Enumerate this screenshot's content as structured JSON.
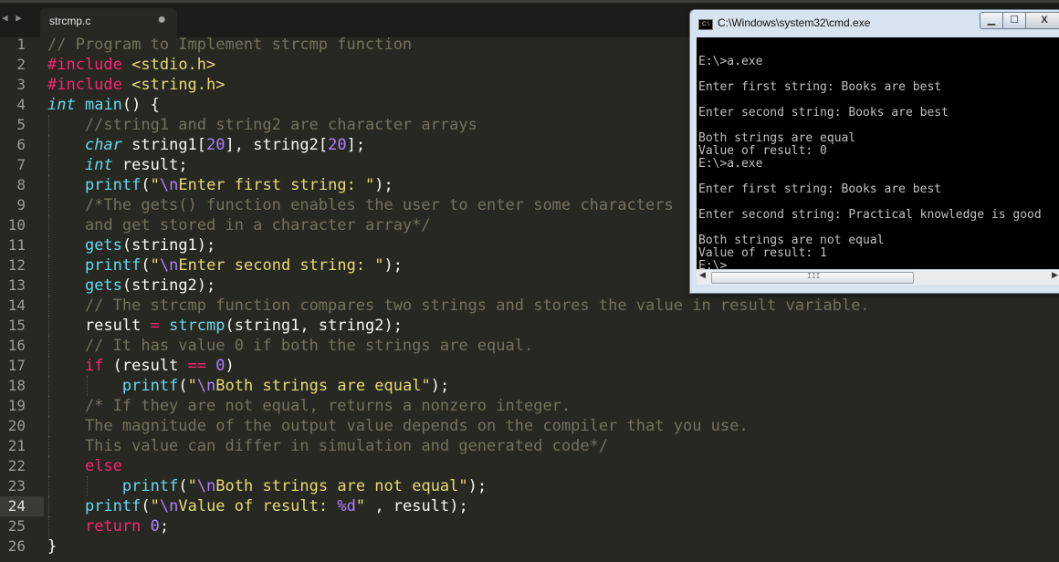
{
  "editor": {
    "tab": {
      "filename": "strcmp.c",
      "modified_dot": "●"
    },
    "nav_arrows": "◀ ▶",
    "active_line": 24,
    "lines": [
      {
        "n": "1",
        "segs": [
          {
            "c": "c",
            "t": "// Program to Implement strcmp function"
          }
        ]
      },
      {
        "n": "2",
        "segs": [
          {
            "c": "k",
            "t": "#include"
          },
          {
            "c": "p",
            "t": " "
          },
          {
            "c": "s",
            "t": "<stdio.h>"
          }
        ]
      },
      {
        "n": "3",
        "segs": [
          {
            "c": "k",
            "t": "#include"
          },
          {
            "c": "p",
            "t": " "
          },
          {
            "c": "s",
            "t": "<string.h>"
          }
        ]
      },
      {
        "n": "4",
        "segs": [
          {
            "c": "t",
            "t": "int"
          },
          {
            "c": "p",
            "t": " "
          },
          {
            "c": "f",
            "t": "main"
          },
          {
            "c": "p",
            "t": "() {"
          }
        ]
      },
      {
        "n": "5",
        "segs": [
          {
            "c": "c",
            "t": "    //string1 and string2 are character arrays"
          }
        ]
      },
      {
        "n": "6",
        "segs": [
          {
            "c": "p",
            "t": "    "
          },
          {
            "c": "t",
            "t": "char"
          },
          {
            "c": "p",
            "t": " string1["
          },
          {
            "c": "n",
            "t": "20"
          },
          {
            "c": "p",
            "t": "], string2["
          },
          {
            "c": "n",
            "t": "20"
          },
          {
            "c": "p",
            "t": "];"
          }
        ]
      },
      {
        "n": "7",
        "segs": [
          {
            "c": "p",
            "t": "    "
          },
          {
            "c": "t",
            "t": "int"
          },
          {
            "c": "p",
            "t": " result;"
          }
        ]
      },
      {
        "n": "8",
        "segs": [
          {
            "c": "p",
            "t": "    "
          },
          {
            "c": "f",
            "t": "printf"
          },
          {
            "c": "p",
            "t": "("
          },
          {
            "c": "s",
            "t": "\""
          },
          {
            "c": "e",
            "t": "\\n"
          },
          {
            "c": "s",
            "t": "Enter first string: \""
          },
          {
            "c": "p",
            "t": ");"
          }
        ]
      },
      {
        "n": "9",
        "segs": [
          {
            "c": "c",
            "t": "    /*The gets() function enables the user to enter some characters"
          }
        ]
      },
      {
        "n": "10",
        "segs": [
          {
            "c": "c",
            "t": "    and get stored in a character array*/"
          }
        ]
      },
      {
        "n": "11",
        "segs": [
          {
            "c": "p",
            "t": "    "
          },
          {
            "c": "f",
            "t": "gets"
          },
          {
            "c": "p",
            "t": "(string1);"
          }
        ]
      },
      {
        "n": "12",
        "segs": [
          {
            "c": "p",
            "t": "    "
          },
          {
            "c": "f",
            "t": "printf"
          },
          {
            "c": "p",
            "t": "("
          },
          {
            "c": "s",
            "t": "\""
          },
          {
            "c": "e",
            "t": "\\n"
          },
          {
            "c": "s",
            "t": "Enter second string: \""
          },
          {
            "c": "p",
            "t": ");"
          }
        ]
      },
      {
        "n": "13",
        "segs": [
          {
            "c": "p",
            "t": "    "
          },
          {
            "c": "f",
            "t": "gets"
          },
          {
            "c": "p",
            "t": "(string2);"
          }
        ]
      },
      {
        "n": "14",
        "segs": [
          {
            "c": "c",
            "t": "    // The strcmp function compares two strings and stores the value in result variable."
          }
        ]
      },
      {
        "n": "15",
        "segs": [
          {
            "c": "p",
            "t": "    result "
          },
          {
            "c": "k",
            "t": "="
          },
          {
            "c": "p",
            "t": " "
          },
          {
            "c": "f",
            "t": "strcmp"
          },
          {
            "c": "p",
            "t": "(string1, string2);"
          }
        ]
      },
      {
        "n": "16",
        "segs": [
          {
            "c": "c",
            "t": "    // It has value 0 if both the strings are equal."
          }
        ]
      },
      {
        "n": "17",
        "segs": [
          {
            "c": "p",
            "t": "    "
          },
          {
            "c": "k",
            "t": "if"
          },
          {
            "c": "p",
            "t": " (result "
          },
          {
            "c": "k",
            "t": "=="
          },
          {
            "c": "p",
            "t": " "
          },
          {
            "c": "n",
            "t": "0"
          },
          {
            "c": "p",
            "t": ")"
          }
        ]
      },
      {
        "n": "18",
        "segs": [
          {
            "c": "p",
            "t": "        "
          },
          {
            "c": "f",
            "t": "printf"
          },
          {
            "c": "p",
            "t": "("
          },
          {
            "c": "s",
            "t": "\""
          },
          {
            "c": "e",
            "t": "\\n"
          },
          {
            "c": "s",
            "t": "Both strings are equal\""
          },
          {
            "c": "p",
            "t": ");"
          }
        ]
      },
      {
        "n": "19",
        "segs": [
          {
            "c": "c",
            "t": "    /* If they are not equal, returns a nonzero integer."
          }
        ]
      },
      {
        "n": "20",
        "segs": [
          {
            "c": "c",
            "t": "    The magnitude of the output value depends on the compiler that you use."
          }
        ]
      },
      {
        "n": "21",
        "segs": [
          {
            "c": "c",
            "t": "    This value can differ in simulation and generated code*/"
          }
        ]
      },
      {
        "n": "22",
        "segs": [
          {
            "c": "p",
            "t": "    "
          },
          {
            "c": "k",
            "t": "else"
          }
        ]
      },
      {
        "n": "23",
        "segs": [
          {
            "c": "p",
            "t": "        "
          },
          {
            "c": "f",
            "t": "printf"
          },
          {
            "c": "p",
            "t": "("
          },
          {
            "c": "s",
            "t": "\""
          },
          {
            "c": "e",
            "t": "\\n"
          },
          {
            "c": "s",
            "t": "Both strings are not equal\""
          },
          {
            "c": "p",
            "t": ");"
          }
        ]
      },
      {
        "n": "24",
        "segs": [
          {
            "c": "p",
            "t": "    "
          },
          {
            "c": "f",
            "t": "printf"
          },
          {
            "c": "p",
            "t": "("
          },
          {
            "c": "s",
            "t": "\""
          },
          {
            "c": "e",
            "t": "\\n"
          },
          {
            "c": "s",
            "t": "Value of result: "
          },
          {
            "c": "n",
            "t": "%d"
          },
          {
            "c": "s",
            "t": "\""
          },
          {
            "c": "p",
            "t": " , result);"
          }
        ]
      },
      {
        "n": "25",
        "segs": [
          {
            "c": "p",
            "t": "    "
          },
          {
            "c": "k",
            "t": "return"
          },
          {
            "c": "p",
            "t": " "
          },
          {
            "c": "n",
            "t": "0"
          },
          {
            "c": "p",
            "t": ";"
          }
        ]
      },
      {
        "n": "26",
        "segs": [
          {
            "c": "p",
            "t": "}"
          }
        ]
      }
    ]
  },
  "cmd": {
    "title": "C:\\Windows\\system32\\cmd.exe",
    "icon_label": "C:\\",
    "buttons": {
      "minimize": "▁",
      "maximize": "☐",
      "close": "X"
    },
    "scroll_grip": "III",
    "console_lines": [
      "",
      "E:\\>a.exe",
      "",
      "Enter first string: Books are best",
      "",
      "Enter second string: Books are best",
      "",
      "Both strings are equal",
      "Value of result: 0",
      "E:\\>a.exe",
      "",
      "Enter first string: Books are best",
      "",
      "Enter second string: Practical knowledge is good",
      "",
      "Both strings are not equal",
      "Value of result: 1",
      "E:\\>"
    ]
  }
}
